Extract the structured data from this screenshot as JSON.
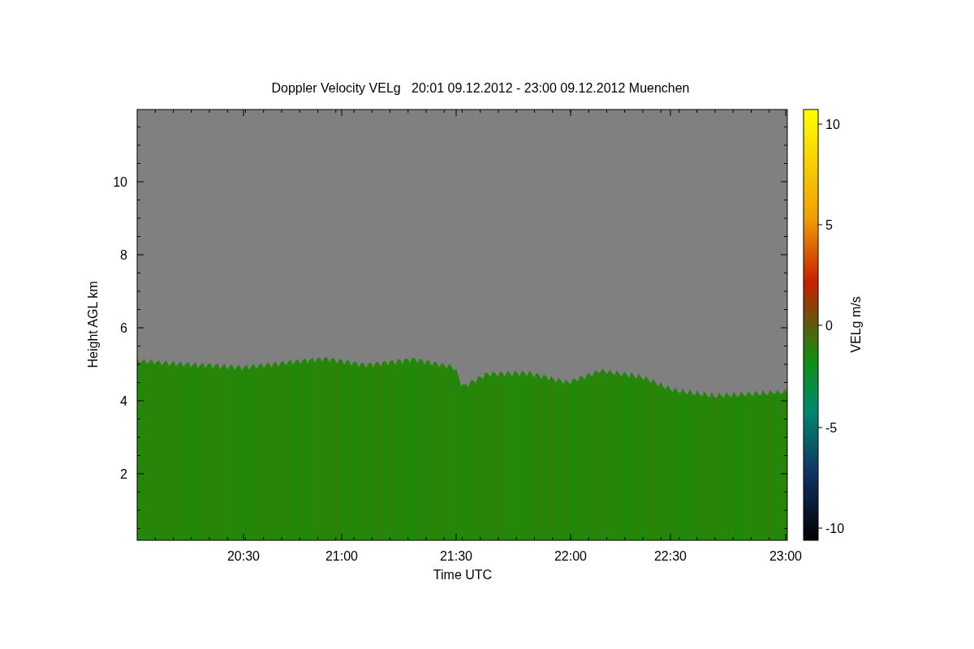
{
  "plot": {
    "title": "Doppler Velocity VELg   20:01 09.12.2012 - 23:00 09.12.2012 Muenchen",
    "ylabel": "Height AGL km",
    "yticks": [
      "10",
      "8",
      "6",
      "4",
      "2"
    ],
    "xlabel": "Time UTC",
    "xticks": [
      "20:30",
      "21:00",
      "21:30",
      "22:00",
      "22:30",
      "23:00"
    ],
    "colorbar": {
      "label": "VELg m/s",
      "ticks": [
        "10",
        "5",
        "0",
        "-5",
        "-10"
      ]
    }
  }
}
